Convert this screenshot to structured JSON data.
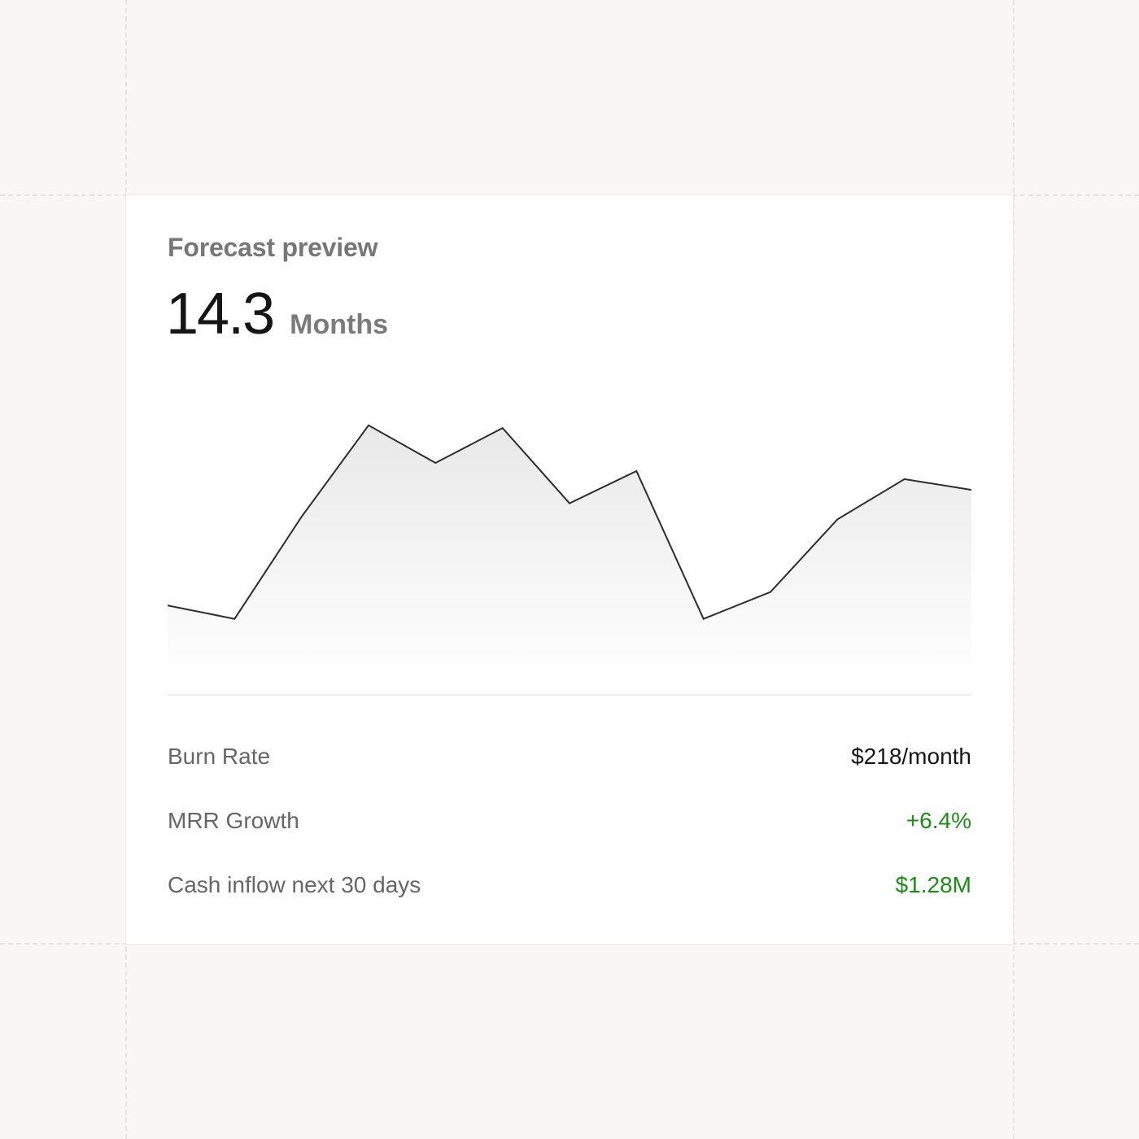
{
  "card": {
    "title": "Forecast preview",
    "metric_value": "14.3",
    "metric_unit": "Months"
  },
  "chart_data": {
    "type": "area",
    "x": [
      1,
      2,
      3,
      4,
      5,
      6,
      7,
      8,
      9,
      10,
      11,
      12,
      13
    ],
    "values": [
      29,
      24,
      62,
      96,
      82,
      95,
      67,
      79,
      24,
      34,
      61,
      76,
      72
    ],
    "ylim": [
      0,
      115
    ],
    "title": "",
    "xlabel": "",
    "ylabel": "",
    "grid": false,
    "axes_visible": false,
    "line_color": "#2d2d2d",
    "fill_color": "#e6e6e6"
  },
  "stats": [
    {
      "label": "Burn Rate",
      "value": "$218/month",
      "value_color": "#161616"
    },
    {
      "label": "MRR Growth",
      "value": "+6.4%",
      "value_color": "#1b8f14"
    },
    {
      "label": "Cash inflow next 30 days",
      "value": "$1.28M",
      "value_color": "#1b8f14"
    }
  ],
  "colors": {
    "background": "#f8f7f5",
    "card": "#ffffff",
    "positive": "#1b8f14"
  }
}
